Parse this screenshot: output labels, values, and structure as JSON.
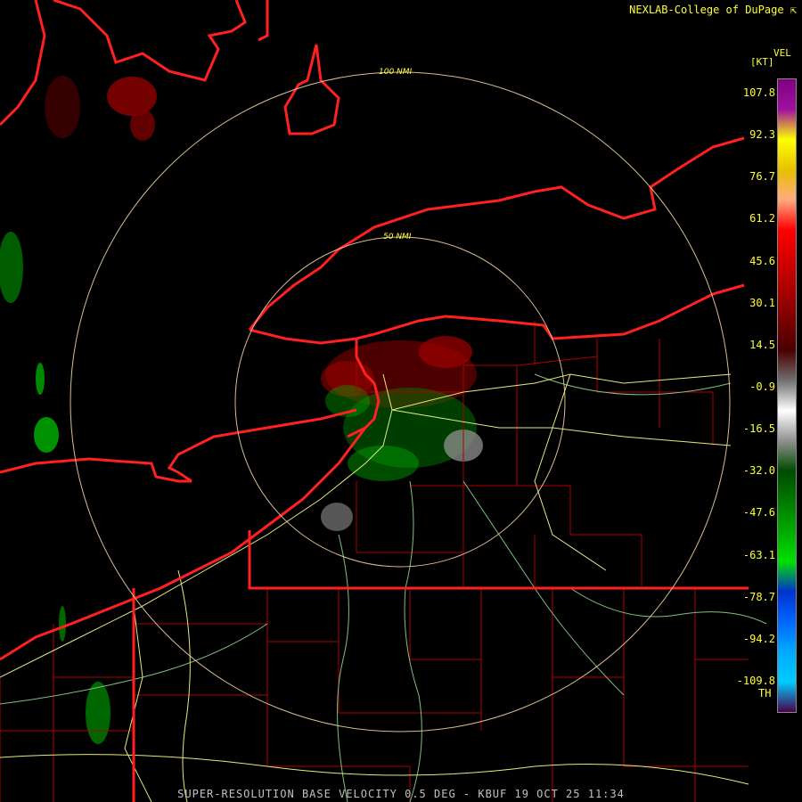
{
  "header": {
    "credit": "NEXLAB-College of DuPage ⇱"
  },
  "legend": {
    "title": "VEL",
    "unit": "[KT]",
    "ticks": [
      "107.8",
      "92.3",
      "76.7",
      "61.2",
      "45.6",
      "30.1",
      "14.5",
      "-0.9",
      "-16.5",
      "-32.0",
      "-47.6",
      "-63.1",
      "-78.7",
      "-94.2",
      "-109.8"
    ],
    "th_label": "TH",
    "colors": [
      "#7f007f",
      "#a010a0",
      "#ffff00",
      "#e8c000",
      "#ffaa80",
      "#ff0000",
      "#d40000",
      "#aa0000",
      "#7a0000",
      "#4a0000",
      "#707070",
      "#ffffff",
      "#909090",
      "#004a00",
      "#007a00",
      "#00aa00",
      "#00e000",
      "#0033cc",
      "#0066ff",
      "#00aaff",
      "#00ccff",
      "#4a004a"
    ]
  },
  "map": {
    "rings": [
      {
        "label": "100 NMI"
      },
      {
        "label": "50 NMI"
      }
    ],
    "colors": {
      "border": "#ff2020",
      "county": "#b00000",
      "road": "#e8e880",
      "river": "#80c080",
      "ring": "#f0d0a0"
    }
  },
  "footer": {
    "title": "SUPER-RESOLUTION BASE VELOCITY 0.5 DEG - KBUF 19 OCT 25 11:34"
  }
}
